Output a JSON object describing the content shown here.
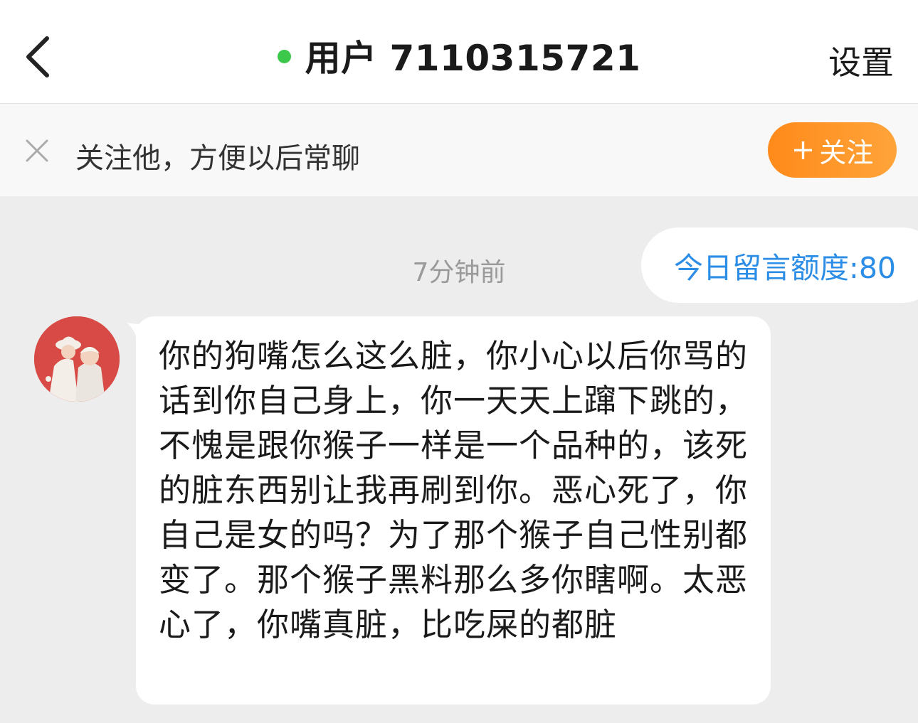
{
  "header": {
    "title": "用户 7110315721",
    "online_color": "#3cc84a",
    "back_icon": "chevron-left-icon",
    "settings_label": "设置"
  },
  "follow_bar": {
    "close_icon": "close-icon",
    "tip_text": "关注他，方便以后常聊",
    "follow_button_label": "关注",
    "follow_button_color": "#ff8a1a"
  },
  "chat": {
    "quota_text": "今日留言额度:80",
    "timestamp": "7分钟前",
    "messages": [
      {
        "sender": "other",
        "text": "你的狗嘴怎么这么脏，你小心以后你骂的话到你自己身上，你一天天上蹿下跳的，不愧是跟你猴子一样是一个品种的，该死的脏东西别让我再刷到你。恶心死了，你自己是女的吗？为了那个猴子自己性别都变了。那个猴子黑料那么多你瞎啊。太恶心了，你嘴真脏，比吃屎的都脏"
      }
    ]
  }
}
